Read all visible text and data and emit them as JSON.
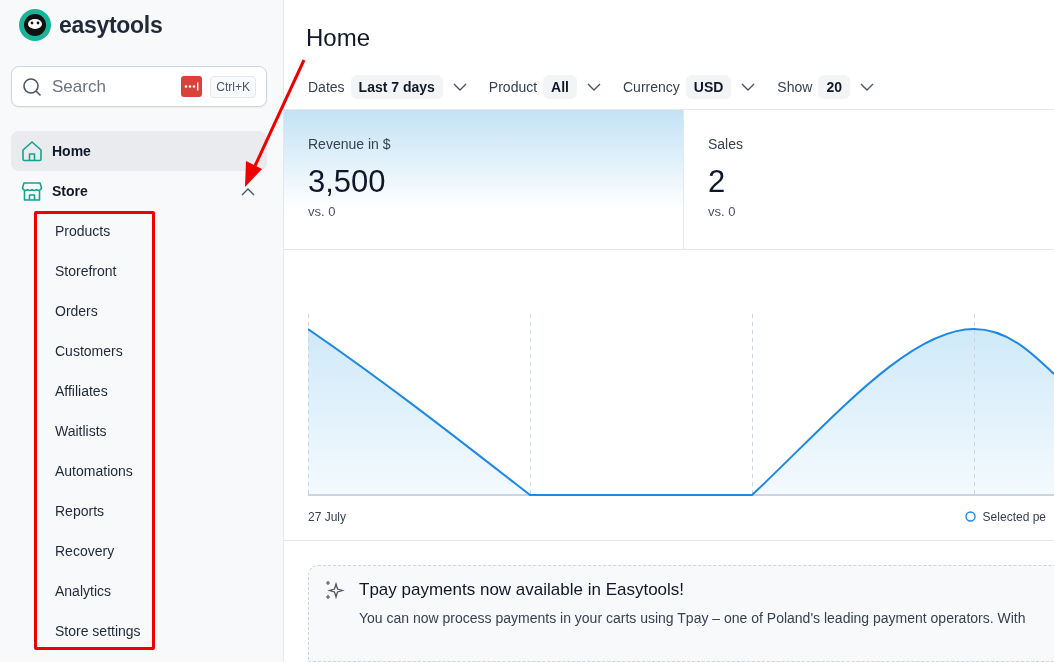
{
  "brand": {
    "name": "easytools"
  },
  "search": {
    "placeholder": "Search",
    "shortcut": "Ctrl+K"
  },
  "nav": [
    {
      "label": "Home",
      "kind": "home",
      "selected": true
    },
    {
      "label": "Store",
      "kind": "store",
      "selected": false,
      "expanded": true,
      "children": [
        {
          "label": "Products"
        },
        {
          "label": "Storefront"
        },
        {
          "label": "Orders"
        },
        {
          "label": "Customers"
        },
        {
          "label": "Affiliates"
        },
        {
          "label": "Waitlists"
        },
        {
          "label": "Automations"
        },
        {
          "label": "Reports"
        },
        {
          "label": "Recovery"
        },
        {
          "label": "Analytics"
        },
        {
          "label": "Store settings"
        }
      ]
    }
  ],
  "annotation": {
    "arrow": true,
    "highlight_box": true
  },
  "page": {
    "title": "Home"
  },
  "filters": [
    {
      "label": "Dates",
      "value": "Last 7 days"
    },
    {
      "label": "Product",
      "value": "All"
    },
    {
      "label": "Currency",
      "value": "USD"
    },
    {
      "label": "Show",
      "value": "20"
    }
  ],
  "stats": [
    {
      "label": "Revenue in $",
      "value": "3,500",
      "compare": "vs. 0",
      "selected": true
    },
    {
      "label": "Sales",
      "value": "2",
      "compare": "vs. 0",
      "selected": false
    }
  ],
  "chart": {
    "start_label": "27 July",
    "legend": "Selected pe"
  },
  "banner": {
    "title": "Tpay payments now available in Easytools!",
    "text": "You can now process payments in your carts using Tpay – one of Poland's leading payment operators. With"
  }
}
